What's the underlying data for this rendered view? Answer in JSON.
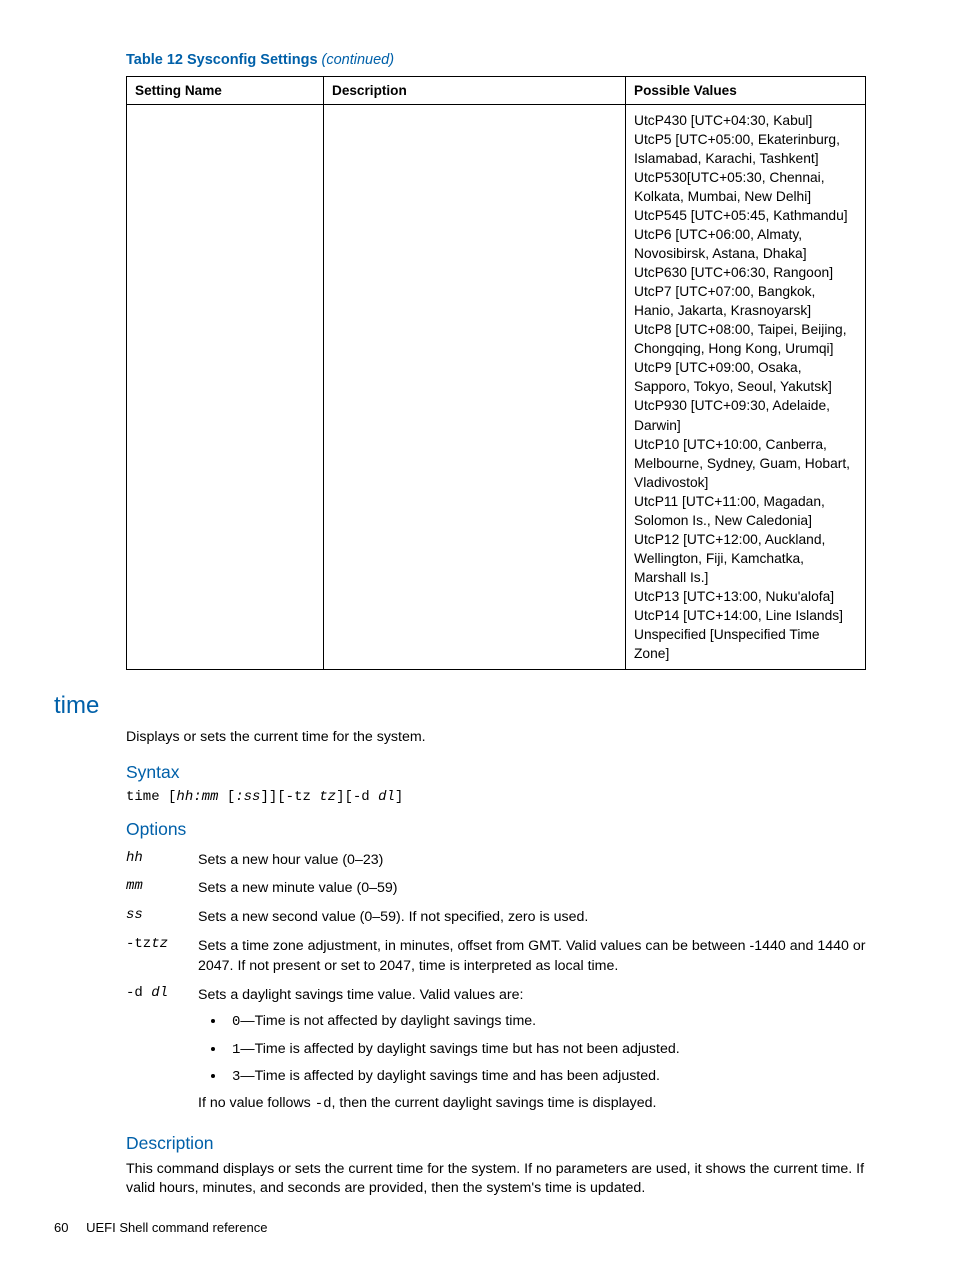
{
  "tableCaption": {
    "prefix": "Table 12 Sysconfig Settings ",
    "suffix": "(continued)"
  },
  "columns": [
    "Setting Name",
    "Description",
    "Possible Values"
  ],
  "possibleValues": [
    "UtcP430 [UTC+04:30, Kabul]",
    "UtcP5 [UTC+05:00, Ekaterinburg, Islamabad, Karachi, Tashkent]",
    "UtcP530[UTC+05:30, Chennai, Kolkata, Mumbai, New Delhi]",
    "UtcP545 [UTC+05:45, Kathmandu]",
    "UtcP6 [UTC+06:00, Almaty, Novosibirsk, Astana, Dhaka]",
    "UtcP630 [UTC+06:30, Rangoon]",
    "UtcP7 [UTC+07:00, Bangkok, Hanio, Jakarta, Krasnoyarsk]",
    "UtcP8 [UTC+08:00, Taipei, Beijing, Chongqing, Hong Kong, Urumqi]",
    "UtcP9 [UTC+09:00, Osaka, Sapporo, Tokyo, Seoul, Yakutsk]",
    "UtcP930 [UTC+09:30, Adelaide, Darwin]",
    "UtcP10 [UTC+10:00, Canberra, Melbourne, Sydney, Guam, Hobart, Vladivostok]",
    "UtcP11 [UTC+11:00, Magadan, Solomon Is., New Caledonia]",
    "UtcP12 [UTC+12:00, Auckland, Wellington, Fiji, Kamchatka, Marshall Is.]",
    "UtcP13 [UTC+13:00, Nuku'alofa]",
    "UtcP14 [UTC+14:00, Line Islands]",
    "Unspecified [Unspecified Time Zone]"
  ],
  "command": {
    "name": "time",
    "summary": "Displays or sets the current time for the system.",
    "headings": {
      "syntax": "Syntax",
      "options": "Options",
      "description": "Description"
    },
    "syntax": {
      "parts": [
        {
          "t": "time",
          "mono": true
        },
        {
          "t": " [",
          "mono": false
        },
        {
          "t": "hh:mm ",
          "mono": true,
          "it": true
        },
        {
          "t": "[",
          "mono": false
        },
        {
          "t": ":ss",
          "mono": true,
          "it": true
        },
        {
          "t": "]][-tz ",
          "mono": true
        },
        {
          "t": "tz",
          "mono": true,
          "it": true
        },
        {
          "t": "][-d ",
          "mono": true
        },
        {
          "t": "dl",
          "mono": true,
          "it": true
        },
        {
          "t": "]",
          "mono": true
        }
      ]
    },
    "options": [
      {
        "k": "hh",
        "kit": true,
        "v": "Sets a new hour value (0–23)"
      },
      {
        "k": "mm",
        "kit": true,
        "v": "Sets a new minute value (0–59)"
      },
      {
        "k": "ss",
        "kit": true,
        "v": "Sets a new second value (0–59). If not specified, zero is used."
      },
      {
        "k": "-tz",
        "k2": "tz",
        "v": "Sets a time zone adjustment, in minutes, offset from GMT. Valid values can be between -1440 and 1440 or 2047. If not present or set to 2047, time is interpreted as local time."
      },
      {
        "k": "-d ",
        "k2": "dl",
        "v": "Sets a daylight savings time value. Valid values are:",
        "bullets": [
          {
            "code": "0",
            "rest": "—Time is not affected by daylight savings time."
          },
          {
            "code": "1",
            "rest": "—Time is affected by daylight savings time but has not been adjusted."
          },
          {
            "code": "3",
            "rest": "—Time is affected by daylight savings time and has been adjusted."
          }
        ],
        "tail": {
          "pre": "If no value follows ",
          "code": "-d",
          "post": ", then the current daylight savings time is displayed."
        }
      }
    ],
    "description": "This command displays or sets the current time for the system. If no parameters are used, it shows the current time. If valid hours, minutes, and seconds are provided, then the system's time is updated."
  },
  "footer": {
    "page": "60",
    "section": "UEFI Shell command reference"
  }
}
